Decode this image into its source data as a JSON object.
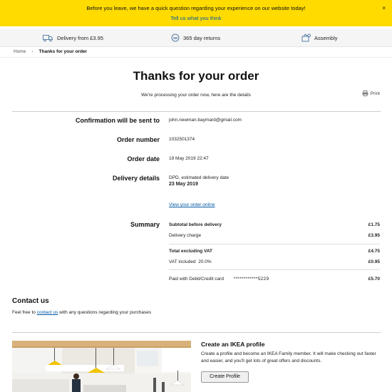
{
  "banner": {
    "message": "Before you leave, we have a quick question regarding your experience on our website today!",
    "link": "Tell us what you think",
    "close": "×",
    "color": "#ffdb00"
  },
  "usp": [
    {
      "label": "Delivery from £3.95",
      "icon": "truck-icon"
    },
    {
      "label": "365 day returns",
      "icon": "returns-icon"
    },
    {
      "label": "Assembly",
      "icon": "assembly-icon"
    }
  ],
  "breadcrumb": {
    "home": "Home",
    "current": "Thanks for your order"
  },
  "page": {
    "title": "Thanks for your order",
    "subtitle": "We're processing your order now, here are the details",
    "print": "Print"
  },
  "details": {
    "confirmation_label": "Confirmation will be sent to",
    "confirmation_value": "john.newman.baymard@gmail.com",
    "order_number_label": "Order number",
    "order_number_value": "1032501374",
    "order_date_label": "Order date",
    "order_date_value": "19 May 2019 22:47",
    "delivery_label": "Delivery details",
    "delivery_method": "DPD, estimated delivery date",
    "delivery_date": "23 May 2019",
    "view_order_link": "View your order online"
  },
  "summary": {
    "label": "Summary",
    "subtotal_label": "Subtotal before delivery",
    "subtotal_value": "£1.75",
    "delivery_label": "Delivery charge",
    "delivery_value": "£3.95",
    "total_label": "Total excluding VAT",
    "total_value": "£4.75",
    "vat_label": "VAT included",
    "vat_rate": "20.0%",
    "vat_value": "£0.95",
    "paid_label": "Paid with Debit/Credit card",
    "card_number": "************5229",
    "paid_value": "£5.70"
  },
  "contact": {
    "heading": "Contact us",
    "text_before": "Feel free to ",
    "link": "contact us",
    "text_after": " with any questions regarding your purchases"
  },
  "profile": {
    "heading": "Create an IKEA profile",
    "text": "Create a profile and become an IKEA Family member. It will make checking out faster and easier, and you'll get lots of great offers and discounts.",
    "button": "Create Profile"
  }
}
